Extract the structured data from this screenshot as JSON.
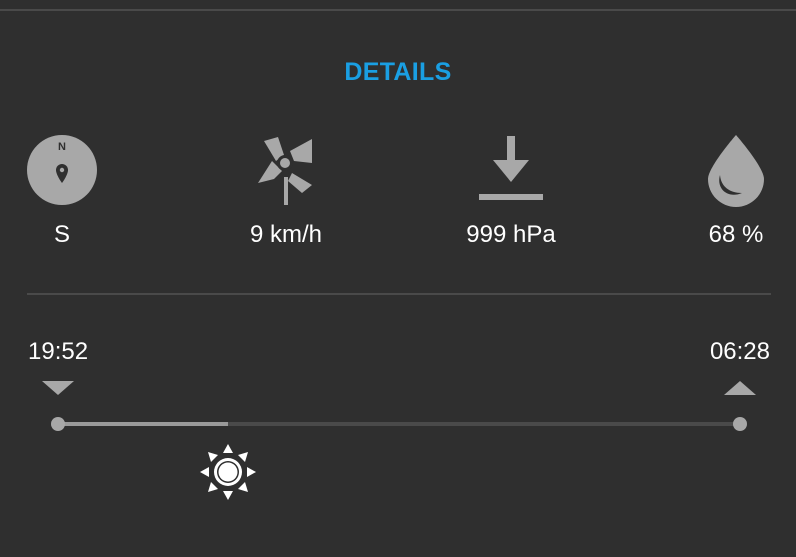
{
  "colors": {
    "accent": "#1a9fe3",
    "icon": "#a8a8a8",
    "background": "#2f2f2f",
    "text": "#ffffff"
  },
  "header": {
    "title": "DETAILS"
  },
  "metrics": [
    {
      "icon": "compass-icon",
      "compass_letter": "N",
      "value": "S"
    },
    {
      "icon": "windmill-icon",
      "value": "9 km/h"
    },
    {
      "icon": "pressure-down-arrow-icon",
      "value": "999 hPa"
    },
    {
      "icon": "water-drop-icon",
      "value": "68 %"
    }
  ],
  "sun": {
    "sunset_time": "19:52",
    "sunrise_time": "06:28",
    "progress": 0.25,
    "indicator_icon": "sun-icon"
  }
}
